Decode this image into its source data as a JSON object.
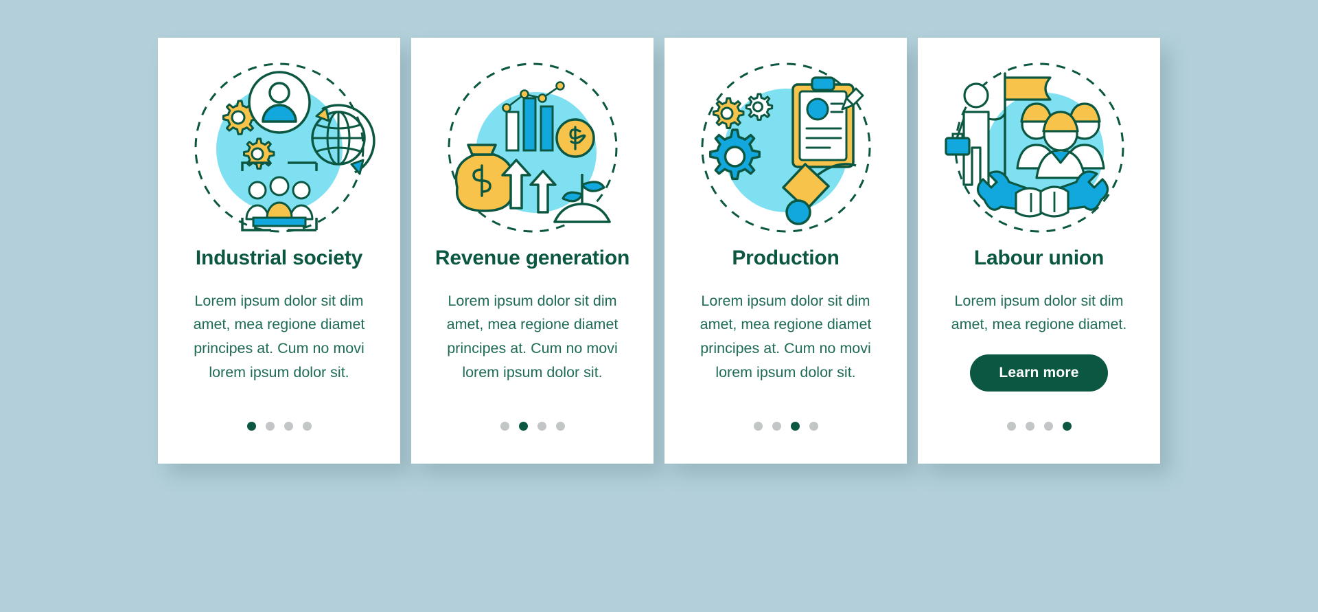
{
  "page": {
    "background_color": "#b3d0da",
    "title": "Onboarding mobile app page screens"
  },
  "palette": {
    "dark_green": "#0b5741",
    "body_green": "#1f6b57",
    "yellow": "#f8c34a",
    "cyan": "#13a8dd",
    "light_cyan": "#7fe0f2",
    "dot_inactive": "#c3c6c6",
    "card_bg": "#ffffff"
  },
  "cards": [
    {
      "illustration": "industrial-society-illustration",
      "title": "Industrial society",
      "body": "Lorem ipsum dolor sit dim amet, mea regione diamet principes at. Cum no movi lorem ipsum dolor sit.",
      "button": null,
      "dots": {
        "count": 4,
        "active_index": 0
      }
    },
    {
      "illustration": "revenue-generation-illustration",
      "title": "Revenue generation",
      "body": "Lorem ipsum dolor sit dim amet, mea regione diamet principes at. Cum no movi lorem ipsum dolor sit.",
      "button": null,
      "dots": {
        "count": 4,
        "active_index": 1
      }
    },
    {
      "illustration": "production-illustration",
      "title": "Production",
      "body": "Lorem ipsum dolor sit dim amet, mea regione diamet principes at. Cum no movi lorem ipsum dolor sit.",
      "button": null,
      "dots": {
        "count": 4,
        "active_index": 2
      }
    },
    {
      "illustration": "labour-union-illustration",
      "title": "Labour union",
      "body": "Lorem ipsum dolor sit dim amet, mea regione diamet.",
      "button": "Learn more",
      "dots": {
        "count": 4,
        "active_index": 3
      }
    }
  ]
}
